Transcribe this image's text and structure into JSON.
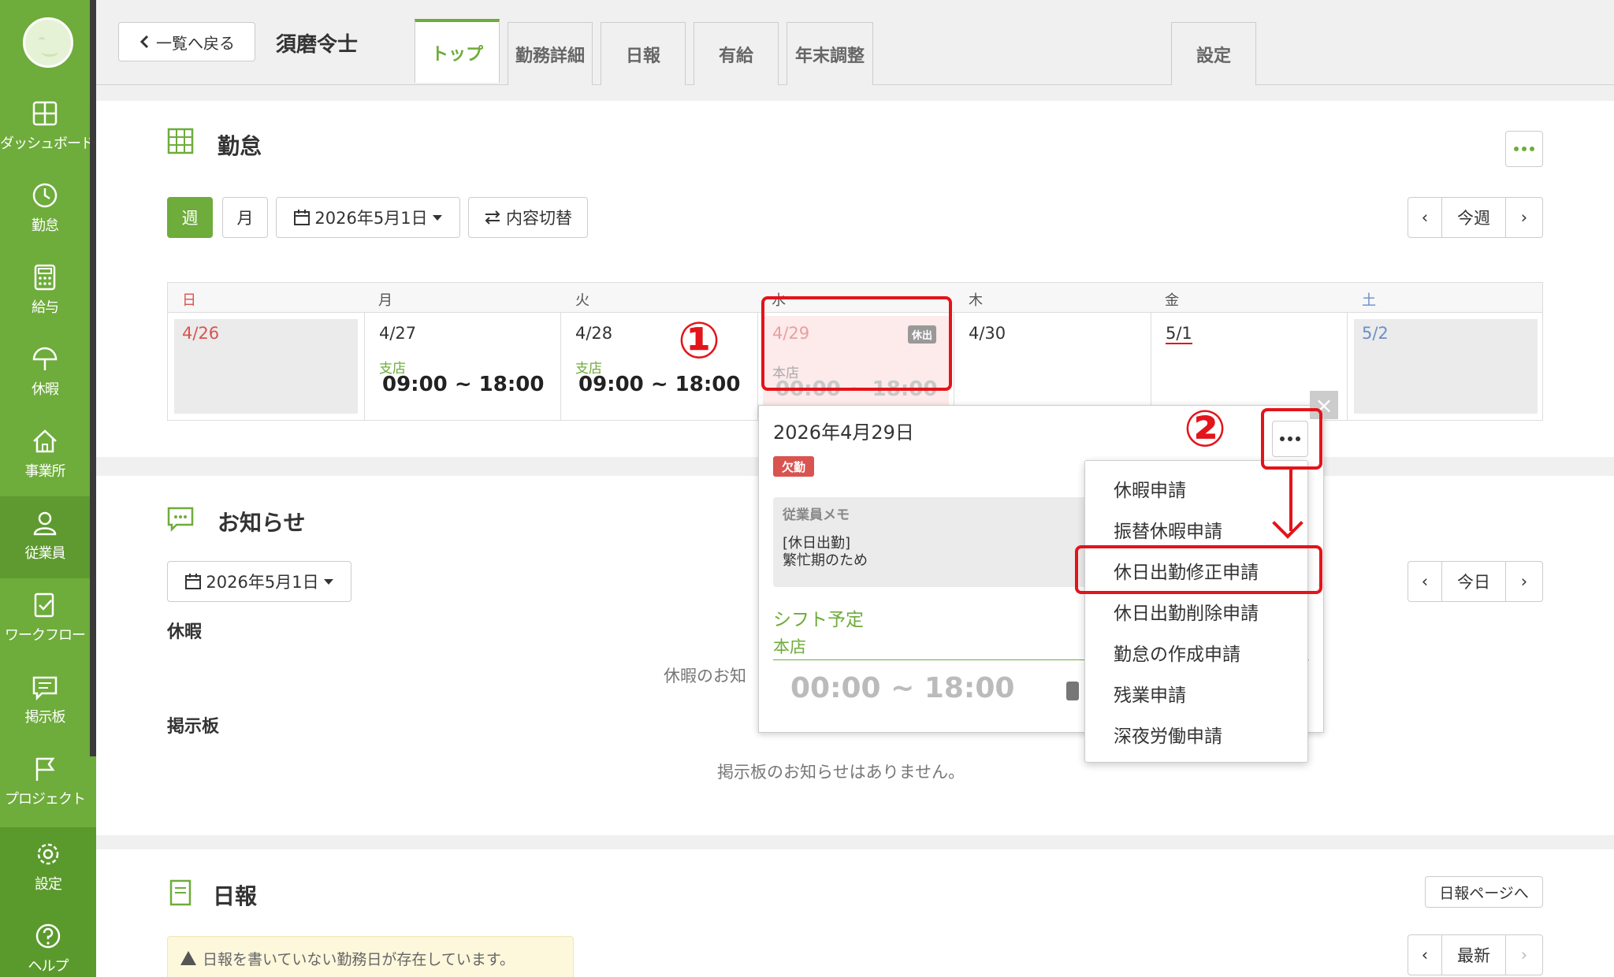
{
  "sidebar": {
    "items": [
      {
        "label": "ダッシュボード",
        "icon": "dashboard-icon"
      },
      {
        "label": "勤怠",
        "icon": "clock-icon"
      },
      {
        "label": "給与",
        "icon": "calculator-icon"
      },
      {
        "label": "休暇",
        "icon": "umbrella-icon"
      },
      {
        "label": "事業所",
        "icon": "home-icon"
      },
      {
        "label": "従業員",
        "icon": "person-icon"
      },
      {
        "label": "ワークフロー",
        "icon": "workflow-icon"
      },
      {
        "label": "掲示板",
        "icon": "chat-icon"
      },
      {
        "label": "プロジェクト",
        "icon": "flag-icon"
      },
      {
        "label": "設定",
        "icon": "gear-icon"
      },
      {
        "label": "ヘルプ",
        "icon": "help-icon"
      }
    ]
  },
  "header": {
    "back_label": "一覧へ戻る",
    "employee_name": "須磨令士",
    "tabs": [
      "トップ",
      "勤務詳細",
      "日報",
      "有給",
      "年末調整"
    ],
    "settings_tab": "設定"
  },
  "attendance": {
    "title": "勤怠",
    "week_btn": "週",
    "month_btn": "月",
    "date_picker": "2026年5月1日",
    "toggle_btn": "内容切替",
    "nav_prev": "‹",
    "nav_today": "今週",
    "nav_next": "›",
    "days": [
      "日",
      "月",
      "火",
      "水",
      "木",
      "金",
      "土"
    ],
    "cells": [
      {
        "date": "4/26"
      },
      {
        "date": "4/27",
        "shop": "支店",
        "shift": "09:00 ~ 18:00"
      },
      {
        "date": "4/28",
        "shop": "支店",
        "shift": "09:00 ~ 18:00"
      },
      {
        "date": "4/29",
        "badge": "休出",
        "shop": "本店",
        "shift": "00:00 ~ 18:00"
      },
      {
        "date": "4/30"
      },
      {
        "date": "5/1"
      },
      {
        "date": "5/2"
      }
    ]
  },
  "annotations": {
    "one": "①",
    "two": "②"
  },
  "popover": {
    "date": "2026年4月29日",
    "status_badge": "欠勤",
    "memo_header": "従業員メモ",
    "memo_text": "[休日出勤]\n繁忙期のため",
    "shift_schedule_label": "シフト予定",
    "shift_shop": "本店",
    "shift_time": "00:00 ~ 18:00",
    "close": "×"
  },
  "dropdown": {
    "items": [
      "休暇申請",
      "振替休暇申請",
      "休日出勤修正申請",
      "休日出勤削除申請",
      "勤怠の作成申請",
      "残業申請",
      "深夜労働申請"
    ],
    "highlighted": "休日出勤修正申請"
  },
  "notices": {
    "title": "お知らせ",
    "date_picker": "2026年5月1日",
    "nav_today": "今日",
    "leave_label": "休暇",
    "leave_empty": "休暇のお知",
    "board_label": "掲示板",
    "board_empty": "掲示板のお知らせはありません。"
  },
  "daily_report": {
    "title": "日報",
    "page_link": "日報ページへ",
    "warning": "日報を書いていない勤務日が存在しています。",
    "nav_latest": "最新"
  },
  "colors": {
    "brand_green": "#6eac3b",
    "annotation_red": "#e3141a",
    "sunday_red": "#d9534f",
    "saturday_blue": "#6a8fc9"
  }
}
